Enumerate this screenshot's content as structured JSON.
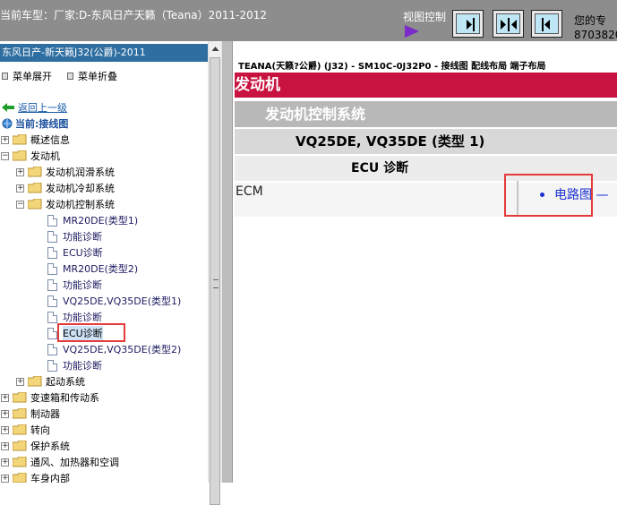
{
  "topbar": {
    "car_label": "当前车型：厂家:D-东风日产天籁（Teana）2011-2012",
    "view_control": "视图控制",
    "user_label": "您的专",
    "user_number": "8703820"
  },
  "sidebar": {
    "model": "东风日产-新天籁J32(公爵)-2011",
    "expand_menu": "菜单展开",
    "collapse_menu": "菜单折叠",
    "back": "返回上一级",
    "current": "当前:接线图",
    "tree": [
      {
        "label": "概述信息"
      },
      {
        "label": "发动机"
      },
      {
        "label": "发动机润滑系统"
      },
      {
        "label": "发动机冷却系统"
      },
      {
        "label": "发动机控制系统"
      },
      {
        "label": "MR20DE(类型1)"
      },
      {
        "label": "功能诊断"
      },
      {
        "label": "ECU诊断"
      },
      {
        "label": "MR20DE(类型2)"
      },
      {
        "label": "功能诊断"
      },
      {
        "label": "VQ25DE,VQ35DE(类型1)"
      },
      {
        "label": "功能诊断"
      },
      {
        "label": "ECU诊断"
      },
      {
        "label": "VQ25DE,VQ35DE(类型2)"
      },
      {
        "label": "功能诊断"
      },
      {
        "label": "起动系统"
      },
      {
        "label": "变速箱和传动系"
      },
      {
        "label": "制动器"
      },
      {
        "label": "转向"
      },
      {
        "label": "保护系统"
      },
      {
        "label": "通风、加热器和空调"
      },
      {
        "label": "车身内部"
      }
    ]
  },
  "content": {
    "doc_title": "TEANA(天籁?公爵) (J32) - SM10C-0J32P0 - 接线图 配线布局 端子布局",
    "level1": "发动机",
    "level2": "发动机控制系统",
    "level3": "VQ25DE, VQ35DE (类型 1)",
    "level4": "ECU 诊断",
    "row_label": "ECM",
    "link": "电路图 —"
  },
  "colors": {
    "topbar": "#8d8d8d",
    "model_bar": "#2f6ea0",
    "level1": "#c8123f",
    "level2": "#b8b8b8",
    "highlight": "#e53a3a",
    "link": "#1a2fd0"
  }
}
